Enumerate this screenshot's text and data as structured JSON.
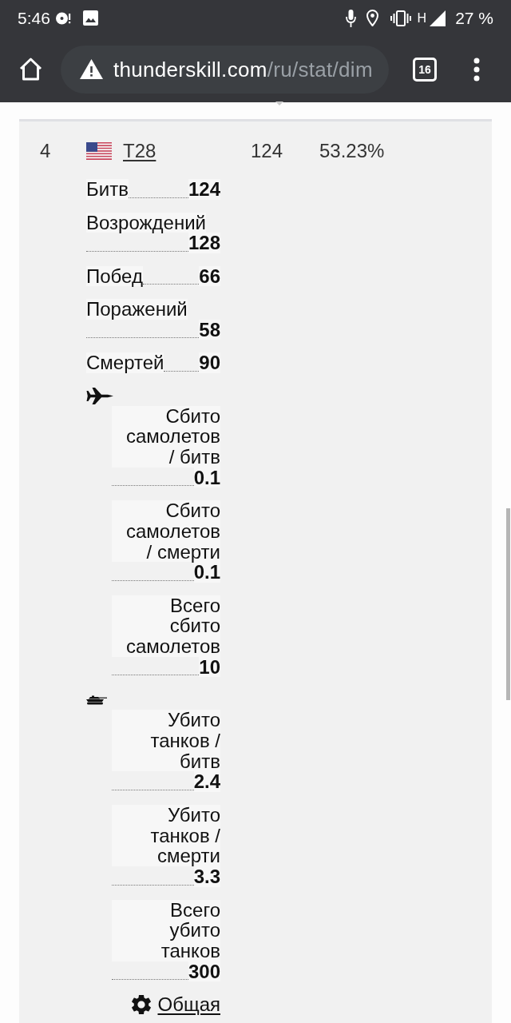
{
  "status_bar": {
    "time": "5:46",
    "network": "H",
    "battery": "27 %"
  },
  "browser": {
    "url_host": "thunderskill.com",
    "url_path": "/ru/stat/dim",
    "tab_count": "16"
  },
  "table": {
    "rows": [
      {
        "column_1": "4",
        "column_2": "T28",
        "column_3": "124",
        "column_4": "53.23%",
        "stats": [
          {
            "label": "Битв",
            "value": "124"
          },
          {
            "label": "Возрождений",
            "value": "128"
          },
          {
            "label": "Побед",
            "value": "66"
          },
          {
            "label": "Поражений",
            "value": "58"
          },
          {
            "label": "Смертей",
            "value": "90"
          }
        ],
        "groups": [
          {
            "kind": "air",
            "stats": [
              {
                "label": "Сбито самолетов / битв",
                "value": "0.1"
              },
              {
                "label": "Сбито самолетов / смерти",
                "value": "0.1"
              },
              {
                "label": "Всего сбито самолетов",
                "value": "10"
              }
            ]
          },
          {
            "kind": "ground",
            "stats": [
              {
                "label": "Убито танков / битв",
                "value": "2.4"
              },
              {
                "label": "Убито танков / смерти",
                "value": "3.3"
              },
              {
                "label": "Всего убито танков",
                "value": "300"
              }
            ]
          }
        ],
        "link": "Общая"
      }
    ]
  }
}
